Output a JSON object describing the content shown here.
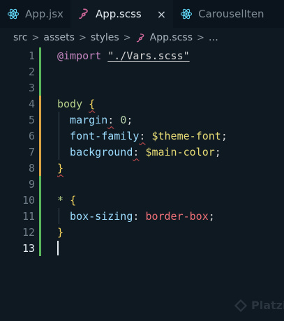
{
  "tabs": [
    {
      "label": "App.jsx",
      "icon": "react-icon",
      "active": false
    },
    {
      "label": "App.scss",
      "icon": "sass-icon",
      "active": true,
      "close": "×"
    },
    {
      "label": "CarouselIten",
      "icon": "react-icon",
      "active": false
    }
  ],
  "breadcrumb": {
    "parts": [
      "src",
      "assets",
      "styles"
    ],
    "file": "App.scss",
    "more": "…",
    "separator": ">"
  },
  "editor": {
    "lines": [
      {
        "n": "1",
        "tokens": [
          [
            "tk-import",
            "@import"
          ],
          [
            "tk-plain",
            " "
          ],
          [
            "tk-string",
            "\"./Vars.scss\""
          ]
        ]
      },
      {
        "n": "2",
        "tokens": []
      },
      {
        "n": "3",
        "tokens": []
      },
      {
        "n": "4",
        "tokens": [
          [
            "tk-sel",
            "body"
          ],
          [
            "tk-plain",
            " "
          ],
          [
            "tk-brace squig",
            "{"
          ]
        ]
      },
      {
        "n": "5",
        "tokens": [
          [
            "tk-prop",
            "  margin"
          ],
          [
            "tk-plain squig",
            ":"
          ],
          [
            "tk-plain",
            " "
          ],
          [
            "tk-num",
            "0"
          ],
          [
            "tk-plain",
            ";"
          ]
        ]
      },
      {
        "n": "6",
        "tokens": [
          [
            "tk-prop",
            "  font-family"
          ],
          [
            "tk-plain squig",
            ":"
          ],
          [
            "tk-plain",
            " "
          ],
          [
            "tk-var",
            "$theme-font"
          ],
          [
            "tk-plain",
            ";"
          ]
        ]
      },
      {
        "n": "7",
        "tokens": [
          [
            "tk-prop",
            "  background"
          ],
          [
            "tk-plain squig",
            ":"
          ],
          [
            "tk-plain",
            " "
          ],
          [
            "tk-var",
            "$main-color"
          ],
          [
            "tk-plain",
            ";"
          ]
        ]
      },
      {
        "n": "8",
        "tokens": [
          [
            "tk-brace squig",
            "}"
          ]
        ]
      },
      {
        "n": "9",
        "tokens": []
      },
      {
        "n": "10",
        "tokens": [
          [
            "tk-sel",
            "*"
          ],
          [
            "tk-plain",
            " "
          ],
          [
            "tk-brace",
            "{"
          ]
        ]
      },
      {
        "n": "11",
        "tokens": [
          [
            "tk-prop",
            "  box-sizing"
          ],
          [
            "tk-plain",
            ":"
          ],
          [
            "tk-plain",
            " "
          ],
          [
            "tk-kw",
            "border-box"
          ],
          [
            "tk-plain",
            ";"
          ]
        ]
      },
      {
        "n": "12",
        "tokens": [
          [
            "tk-brace",
            "}"
          ]
        ]
      },
      {
        "n": "13",
        "tokens": []
      }
    ],
    "current_line": "13"
  },
  "watermark": {
    "text": "Platzi",
    "icon": "platzi-logo-icon"
  },
  "colors": {
    "background": "#0f1922",
    "tabbar": "#0b141c",
    "added": "#5bb75b",
    "modified": "#d9a441",
    "sass": "#cd6799",
    "react": "#61dafb"
  }
}
